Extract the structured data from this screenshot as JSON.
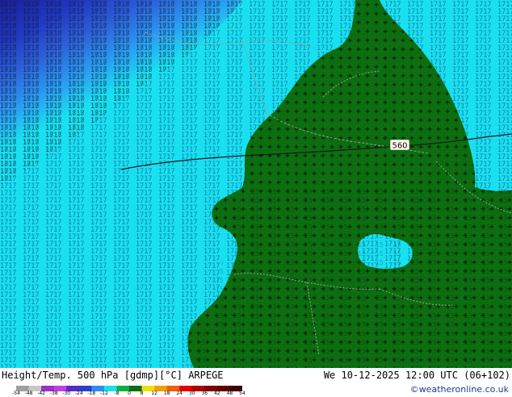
{
  "map": {
    "contour_label": "560",
    "colors": {
      "deep_blue": "#1f2fa8",
      "blue": "#2c4fd4",
      "light_blue": "#2f8cf0",
      "cyan": "#19e0f0",
      "green": "#0c6e10",
      "contour_line": "#1a1a1a",
      "border": "#9a9a9a"
    }
  },
  "footer": {
    "title_left": "Height/Temp. 500 hPa [gdmp][°C] ARPEGE",
    "title_right": "We 10-12-2025 12:00 UTC (06+102)",
    "credit": "©weatheronline.co.uk"
  },
  "legend": {
    "ticks": [
      "-54",
      "-48",
      "-42",
      "-38",
      "-30",
      "-24",
      "-18",
      "-12",
      "-8",
      "0",
      "8",
      "12",
      "18",
      "24",
      "30",
      "36",
      "42",
      "48",
      "54"
    ],
    "colors": [
      "#a0a0a0",
      "#c8c8c8",
      "#9b30c8",
      "#c040e0",
      "#5a28c8",
      "#2a3ed0",
      "#2f8cf0",
      "#19e0f0",
      "#10b040",
      "#0c6e10",
      "#f0e000",
      "#f0a000",
      "#f06000",
      "#e00000",
      "#b00000",
      "#800000",
      "#600000",
      "#400000"
    ]
  }
}
